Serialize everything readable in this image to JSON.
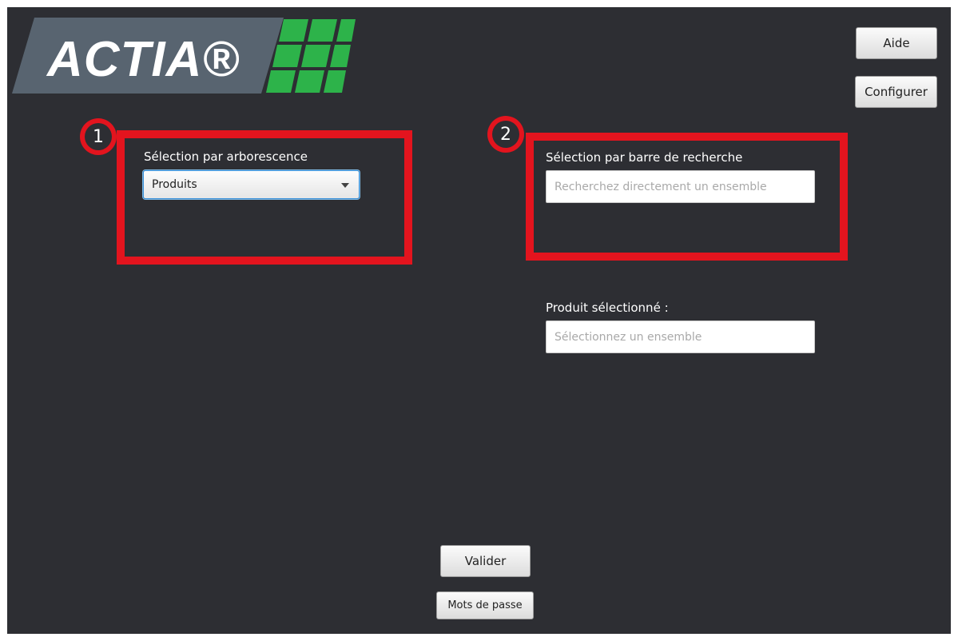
{
  "header": {
    "logo_text": "ACTIA®",
    "help_label": "Aide",
    "configure_label": "Configurer"
  },
  "tree_section": {
    "badge": "1",
    "title": "Sélection par arborescence",
    "dropdown_value": "Produits"
  },
  "search_section": {
    "badge": "2",
    "title": "Sélection par barre de recherche",
    "search_placeholder": "Recherchez directement un ensemble"
  },
  "selected_product": {
    "label": "Produit sélectionné :",
    "placeholder": "Sélectionnez un ensemble"
  },
  "footer": {
    "validate_label": "Valider",
    "passwords_label": "Mots de passe"
  },
  "colors": {
    "background": "#2d2e33",
    "highlight_red": "#e3141e",
    "logo_green": "#2db34a",
    "logo_gray": "#586470"
  }
}
